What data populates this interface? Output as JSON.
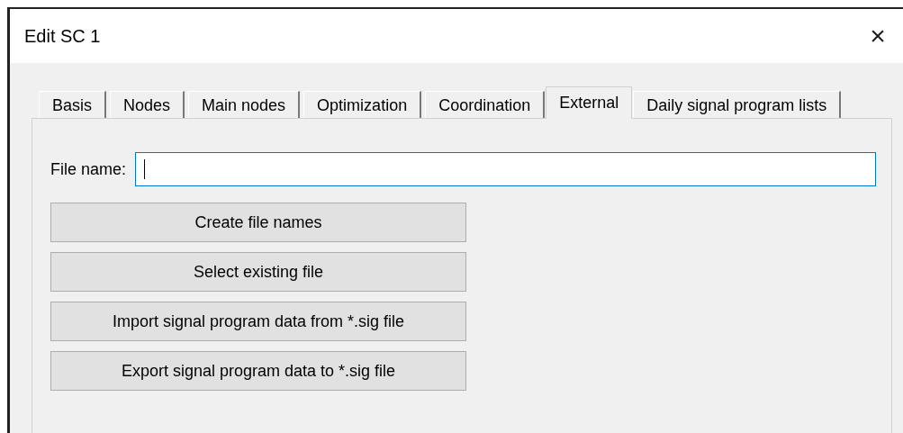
{
  "window": {
    "title": "Edit SC 1",
    "close": "×"
  },
  "tabs": [
    {
      "label": "Basis",
      "selected": false
    },
    {
      "label": "Nodes",
      "selected": false
    },
    {
      "label": "Main nodes",
      "selected": false
    },
    {
      "label": "Optimization",
      "selected": false
    },
    {
      "label": "Coordination",
      "selected": false
    },
    {
      "label": "External",
      "selected": true
    },
    {
      "label": "Daily signal program lists",
      "selected": false
    }
  ],
  "file_name": {
    "label": "File name:",
    "focused": true
  },
  "buttons": [
    "Create file names",
    "Select existing file",
    "Import signal program data from *.sig file",
    "Export signal program data to *.sig file"
  ]
}
